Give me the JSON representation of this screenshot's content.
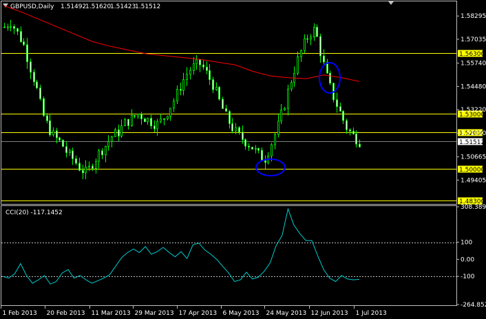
{
  "chart_data": [
    {
      "type": "candlestick",
      "header": {
        "symbol": "GBPUSD,Daily",
        "ohlc": [
          "1.51492",
          "1.51620",
          "1.51423",
          "1.51512"
        ]
      },
      "ylim": [
        1.4815,
        1.5905
      ],
      "y_ticks": [
        "1.58295",
        "1.57035",
        "1.55740",
        "1.54480",
        "1.53220",
        "1.51950",
        "1.50665",
        "1.49405"
      ],
      "current_price": "1.51512",
      "levels": [
        {
          "value": 1.563,
          "label": "1.56300"
        },
        {
          "value": 1.53,
          "label": "1.53000"
        },
        {
          "value": 1.52,
          "label": "1.52000"
        },
        {
          "value": 1.5,
          "label": "1.50000"
        },
        {
          "value": 1.483,
          "label": "1.48300"
        }
      ],
      "moving_average": {
        "color": "#ff0000",
        "values": [
          1.5885,
          1.585,
          1.581,
          1.577,
          1.573,
          1.569,
          1.5665,
          1.5645,
          1.5625,
          1.5615,
          1.5605,
          1.5595,
          1.558,
          1.5565,
          1.553,
          1.5505,
          1.5495,
          1.549,
          1.551,
          1.5495,
          1.5475
        ]
      },
      "close": [
        1.577,
        1.58,
        1.574,
        1.568,
        1.556,
        1.545,
        1.53,
        1.522,
        1.517,
        1.514,
        1.508,
        1.505,
        1.5,
        1.498,
        1.504,
        1.509,
        1.513,
        1.518,
        1.52,
        1.525,
        1.527,
        1.53,
        1.528,
        1.526,
        1.524,
        1.527,
        1.533,
        1.539,
        1.547,
        1.553,
        1.556,
        1.557,
        1.551,
        1.545,
        1.536,
        1.528,
        1.522,
        1.518,
        1.515,
        1.512,
        1.508,
        1.505,
        1.513,
        1.522,
        1.533,
        1.546,
        1.557,
        1.566,
        1.573,
        1.576,
        1.561,
        1.548,
        1.538,
        1.53,
        1.522,
        1.518,
        1.515
      ],
      "annotations": [
        {
          "type": "ellipse",
          "color": "#0000ff",
          "near": "24 May 2013 low"
        },
        {
          "type": "ellipse",
          "color": "#0000ff",
          "near": "mid June 2013 high"
        }
      ],
      "line_color": "#00ff00"
    },
    {
      "type": "line",
      "header": "CCI(20) -117.1452",
      "ylim": [
        -264.8526,
        308.3895
      ],
      "y_ticks": [
        "308.3895",
        "100",
        "0.00",
        "-100",
        "-264.8526"
      ],
      "reference_lines": [
        100,
        -100
      ],
      "line_color": "#00ced1",
      "values": [
        -100,
        -110,
        -85,
        -25,
        -95,
        -140,
        -120,
        -95,
        -145,
        -130,
        -80,
        -60,
        -110,
        -95,
        -120,
        -140,
        -125,
        -110,
        -90,
        -40,
        10,
        40,
        60,
        40,
        75,
        30,
        45,
        70,
        40,
        15,
        45,
        5,
        85,
        95,
        55,
        30,
        0,
        -40,
        -80,
        -130,
        -120,
        -75,
        -115,
        -105,
        -70,
        -20,
        80,
        140,
        295,
        200,
        150,
        110,
        110,
        20,
        -60,
        -110,
        -130,
        -95,
        -115,
        -120,
        -117
      ]
    }
  ],
  "x_ticks": [
    "1 Feb 2013",
    "20 Feb 2013",
    "11 Mar 2013",
    "29 Mar 2013",
    "17 Apr 2013",
    "6 May 2013",
    "24 May 2013",
    "12 Jun 2013",
    "1 Jul 2013"
  ],
  "colors": {
    "background": "#000000",
    "frame": "#c0c0c0",
    "level_line": "#ffff00",
    "price_label_bg": "#ffff00",
    "current_label_bg": "#ffffff",
    "dotted": "#c0c0c0"
  },
  "ui": {
    "collapse_icon": "triangle-down-icon"
  }
}
